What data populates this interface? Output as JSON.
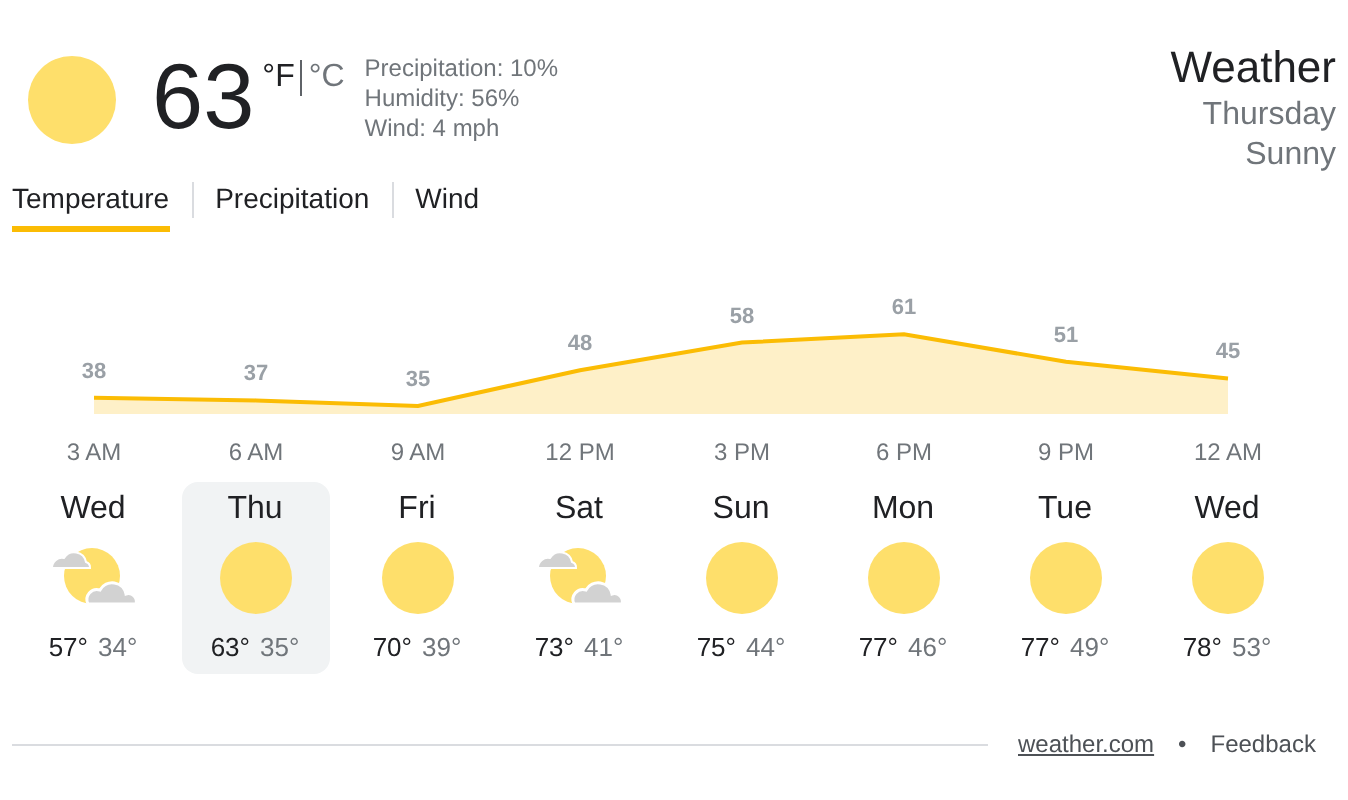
{
  "current": {
    "kind": "sunny",
    "temperature": "63",
    "units": [
      {
        "label": "°F",
        "selected": true
      },
      {
        "label": "°C",
        "selected": false
      }
    ],
    "details": [
      "Precipitation: 10%",
      "Humidity: 56%",
      "Wind: 4 mph"
    ]
  },
  "header": {
    "title": "Weather",
    "day": "Thursday",
    "condition": "Sunny"
  },
  "tabs": [
    {
      "label": "Temperature",
      "selected": true
    },
    {
      "label": "Precipitation",
      "selected": false
    },
    {
      "label": "Wind",
      "selected": false
    }
  ],
  "chart_data": {
    "type": "area",
    "categories": [
      "3 AM",
      "6 AM",
      "9 AM",
      "12 PM",
      "3 PM",
      "6 PM",
      "9 PM",
      "12 AM"
    ],
    "series": [
      {
        "color": "#fbbc04",
        "values": [
          38,
          37,
          35,
          48,
          58,
          61,
          51,
          45
        ]
      }
    ],
    "data_labels": true
  },
  "days": [
    {
      "day": "Wed",
      "kind": "partly_cloudy",
      "high": "57°",
      "low": "34°",
      "selected": false
    },
    {
      "day": "Thu",
      "kind": "sunny",
      "high": "63°",
      "low": "35°",
      "selected": true
    },
    {
      "day": "Fri",
      "kind": "sunny",
      "high": "70°",
      "low": "39°",
      "selected": false
    },
    {
      "day": "Sat",
      "kind": "partly_cloudy",
      "high": "73°",
      "low": "41°",
      "selected": false
    },
    {
      "day": "Sun",
      "kind": "sunny",
      "high": "75°",
      "low": "44°",
      "selected": false
    },
    {
      "day": "Mon",
      "kind": "sunny",
      "high": "77°",
      "low": "46°",
      "selected": false
    },
    {
      "day": "Tue",
      "kind": "sunny",
      "high": "77°",
      "low": "49°",
      "selected": false
    },
    {
      "day": "Wed",
      "kind": "sunny",
      "high": "78°",
      "low": "53°",
      "selected": false
    }
  ],
  "footer": {
    "source": "weather.com",
    "separator": "•",
    "feedback": "Feedback"
  }
}
